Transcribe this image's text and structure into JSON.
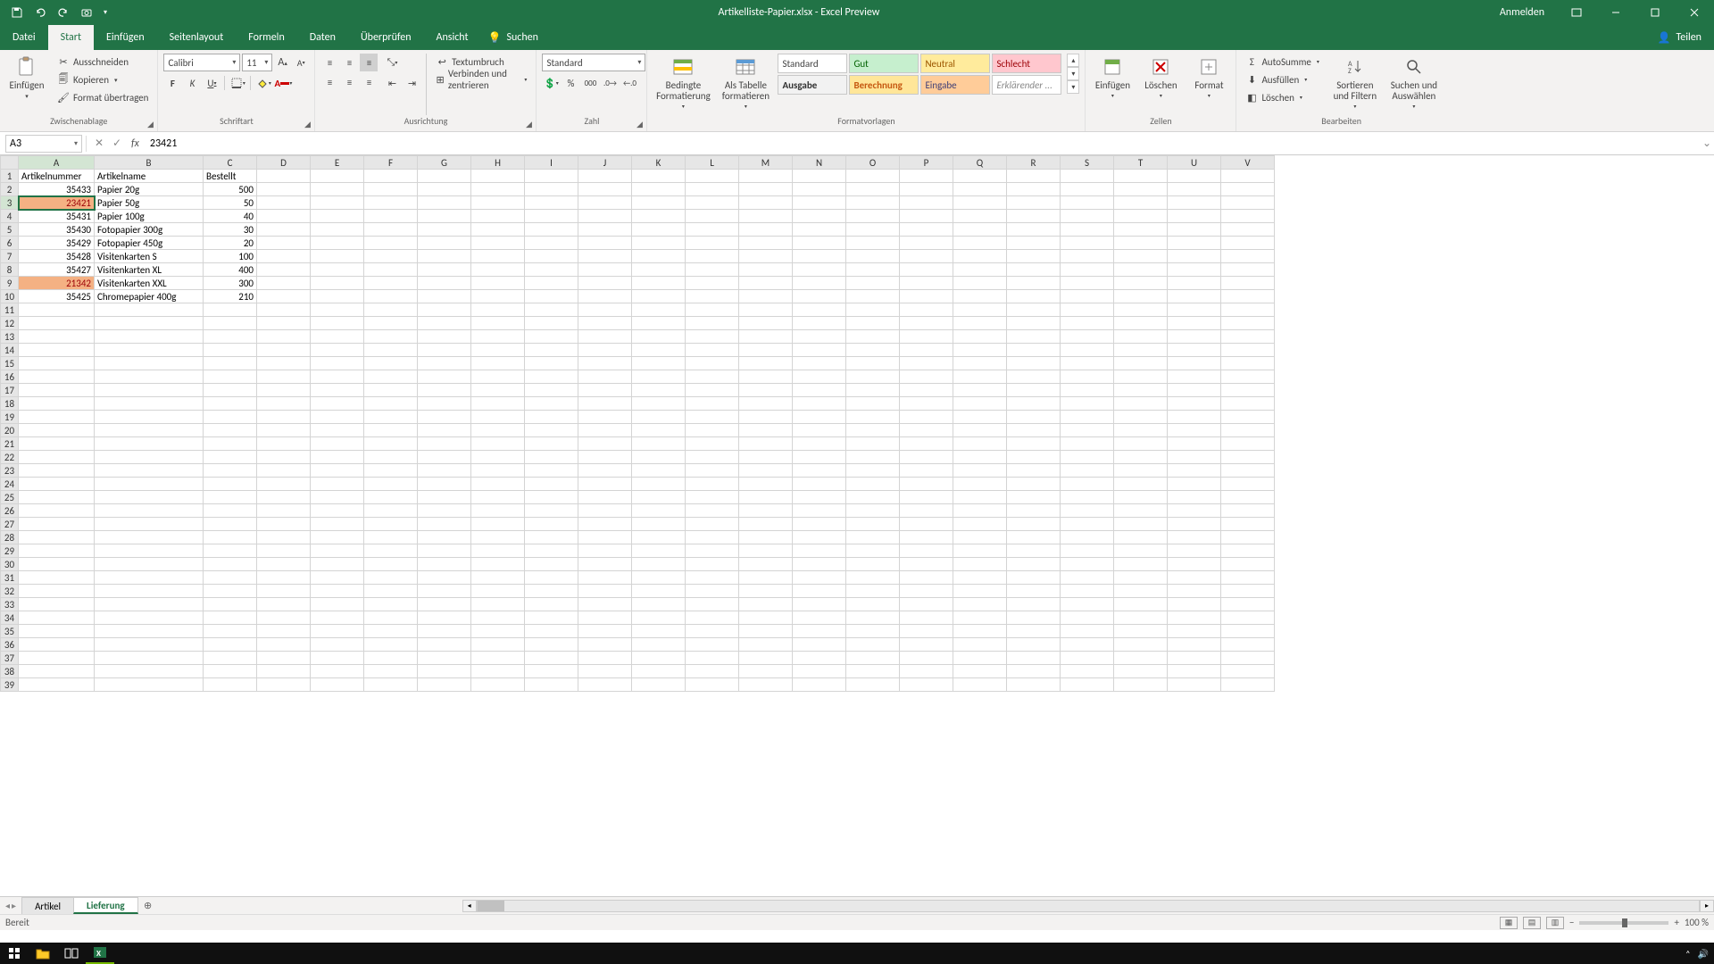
{
  "window": {
    "title": "Artikelliste-Papier.xlsx  -  Excel Preview",
    "login": "Anmelden"
  },
  "tabs": {
    "datei": "Datei",
    "start": "Start",
    "einfuegen": "Einfügen",
    "seitenlayout": "Seitenlayout",
    "formeln": "Formeln",
    "daten": "Daten",
    "ueberpruefen": "Überprüfen",
    "ansicht": "Ansicht",
    "suchen": "Suchen",
    "teilen": "Teilen"
  },
  "ribbon": {
    "paste": "Einfügen",
    "cut": "Ausschneiden",
    "copy": "Kopieren",
    "fmtpaint": "Format übertragen",
    "clipboard_label": "Zwischenablage",
    "font_name": "Calibri",
    "font_size": "11",
    "font_label": "Schriftart",
    "wrap": "Textumbruch",
    "merge": "Verbinden und zentrieren",
    "align_label": "Ausrichtung",
    "num_format": "Standard",
    "num_label": "Zahl",
    "cond_fmt": "Bedingte Formatierung",
    "as_table": "Als Tabelle formatieren",
    "style_standard": "Standard",
    "style_gut": "Gut",
    "style_neutral": "Neutral",
    "style_schlecht": "Schlecht",
    "style_ausgabe": "Ausgabe",
    "style_berechnung": "Berechnung",
    "style_eingabe": "Eingabe",
    "style_erkl": "Erklärender ...",
    "styles_label": "Formatvorlagen",
    "insert": "Einfügen",
    "delete": "Löschen",
    "format": "Format",
    "cells_label": "Zellen",
    "autosum": "AutoSumme",
    "fill": "Ausfüllen",
    "clear": "Löschen",
    "sort": "Sortieren und Filtern",
    "find": "Suchen und Auswählen",
    "edit_label": "Bearbeiten"
  },
  "formula": {
    "name_box": "A3",
    "value": "23421"
  },
  "columns": [
    "A",
    "B",
    "C",
    "D",
    "E",
    "F",
    "G",
    "H",
    "I",
    "J",
    "K",
    "L",
    "M",
    "N",
    "O",
    "P",
    "Q",
    "R",
    "S",
    "T",
    "U",
    "V"
  ],
  "headers": {
    "a": "Artikelnummer",
    "b": "Artikelname",
    "c": "Bestellt"
  },
  "rows": [
    {
      "n": 2,
      "a": "35433",
      "b": "Papier 20g",
      "c": "500",
      "hl": false
    },
    {
      "n": 3,
      "a": "23421",
      "b": "Papier 50g",
      "c": "50",
      "hl": true,
      "active": true
    },
    {
      "n": 4,
      "a": "35431",
      "b": "Papier 100g",
      "c": "40",
      "hl": false
    },
    {
      "n": 5,
      "a": "35430",
      "b": "Fotopapier 300g",
      "c": "30",
      "hl": false
    },
    {
      "n": 6,
      "a": "35429",
      "b": "Fotopapier 450g",
      "c": "20",
      "hl": false
    },
    {
      "n": 7,
      "a": "35428",
      "b": "Visitenkarten S",
      "c": "100",
      "hl": false
    },
    {
      "n": 8,
      "a": "35427",
      "b": "Visitenkarten XL",
      "c": "400",
      "hl": false
    },
    {
      "n": 9,
      "a": "21342",
      "b": "Visitenkarten XXL",
      "c": "300",
      "hl": true
    },
    {
      "n": 10,
      "a": "35425",
      "b": "Chromepapier 400g",
      "c": "210",
      "hl": false
    }
  ],
  "sheets": {
    "artikel": "Artikel",
    "lieferung": "Lieferung"
  },
  "status": {
    "ready": "Bereit",
    "zoom": "100 %"
  }
}
